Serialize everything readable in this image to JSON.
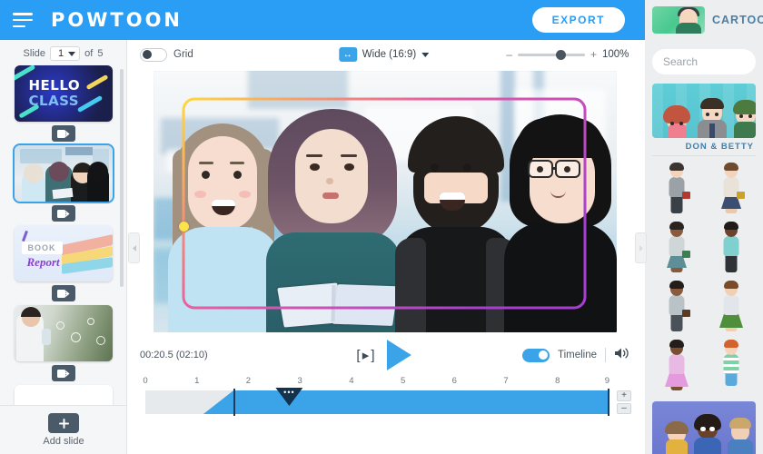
{
  "header": {
    "brand": "POWTOON",
    "menu_icon": "hamburger-icon",
    "export_label": "EXPORT",
    "library_tab_label": "CARTOON"
  },
  "slides_panel": {
    "slide_word": "Slide",
    "current_slide": "1",
    "of_word": "of",
    "total_slides": "5",
    "add_slide_label": "Add slide",
    "add_slide_icon": "plus-icon",
    "insert_icon": "insert-slide-icon",
    "slides": [
      {
        "index": "1",
        "type": "hello-class",
        "title_line1": "HELLO",
        "title_line2": "CLASS",
        "selected": false
      },
      {
        "index": "2",
        "type": "classroom-characters",
        "selected": true
      },
      {
        "index": "3",
        "type": "book-report",
        "banner_text": "BOOK",
        "script_text": "Report",
        "selected": false
      },
      {
        "index": "4",
        "type": "photo-bubbles",
        "selected": false
      },
      {
        "index": "5",
        "type": "blank",
        "selected": false
      }
    ]
  },
  "toolbar": {
    "grid_label": "Grid",
    "grid_on": false,
    "ratio_label": "Wide (16:9)",
    "ratio_icon": "resize-horizontal-icon",
    "ratio_caret": "chevron-down-icon",
    "zoom_minus": "–",
    "zoom_plus": "+",
    "zoom_value": "100%"
  },
  "canvas": {
    "selection_shape": "rounded-rectangle-outline",
    "gradient_start": "#ffd83d",
    "gradient_end": "#a63ed1",
    "anchor_color": "#ffe14d",
    "characters": [
      "blonde-girl-light-blue",
      "photo-girl-with-book",
      "bearded-man",
      "dark-hair-glasses-girl"
    ]
  },
  "playback": {
    "time_current": "00:20.5",
    "time_total": "(02:10)",
    "preview_slide_icon": "[ ▸ ]",
    "play_icon": "play-icon",
    "timeline_label": "Timeline",
    "timeline_on": true,
    "volume_icon": "speaker-icon"
  },
  "timeline": {
    "ticks": [
      "0",
      "1",
      "2",
      "3",
      "4",
      "5",
      "6",
      "7",
      "8",
      "9"
    ],
    "playhead_position": "3",
    "playhead_glyph": "•••",
    "zoom_in": "+",
    "zoom_out": "–",
    "bar_color": "#3ba3e8"
  },
  "library": {
    "search_placeholder": "Search",
    "banner_title": "DON & BETTY",
    "characters": [
      {
        "name": "businessman-grey-suit",
        "skin": "#f3d3bb",
        "hair": "#3b3430",
        "top": "#9aa2a8",
        "bottom": "#3a4048",
        "accent": "#b3392f",
        "female": false
      },
      {
        "name": "businesswoman-blue-skirt",
        "skin": "#f3d3bb",
        "hair": "#6f4b2e",
        "top": "#e9e2d8",
        "bottom": "#3c4d72",
        "accent": "#c9a227",
        "female": true
      },
      {
        "name": "woman-teal-dress",
        "skin": "#8a5a3c",
        "hair": "#2a2320",
        "top": "#cfd6d8",
        "bottom": "#5f8f96",
        "accent": "#3f7d52",
        "female": true
      },
      {
        "name": "man-teal-shirt",
        "skin": "#6e4329",
        "hair": "#201b18",
        "top": "#7fd0cf",
        "bottom": "#2f3338",
        "accent": "#2f6f6e",
        "female": false
      },
      {
        "name": "man-grey-shirt-briefcase",
        "skin": "#8a5a3c",
        "hair": "#241d1a",
        "top": "#b9c2c7",
        "bottom": "#4a5159",
        "accent": "#5a3a22",
        "female": false
      },
      {
        "name": "woman-green-dress",
        "skin": "#f0cfb4",
        "hair": "#7b4a28",
        "top": "#e2e6ea",
        "bottom": "#4f8f3c",
        "accent": "#4f8f3c",
        "female": true
      },
      {
        "name": "girl-pink-dress",
        "skin": "#7b4e33",
        "hair": "#241d1a",
        "top": "#e8b9e3",
        "bottom": "#e49bdd",
        "accent": "#d87fd0",
        "female": true
      },
      {
        "name": "boy-striped-shirt",
        "skin": "#f3d3bb",
        "hair": "#d4622c",
        "top": "#7fd2a8",
        "bottom": "#5aa9dd",
        "accent": "#3f6fbf",
        "female": false
      }
    ],
    "bottom_banner": "group-characters-purple"
  }
}
